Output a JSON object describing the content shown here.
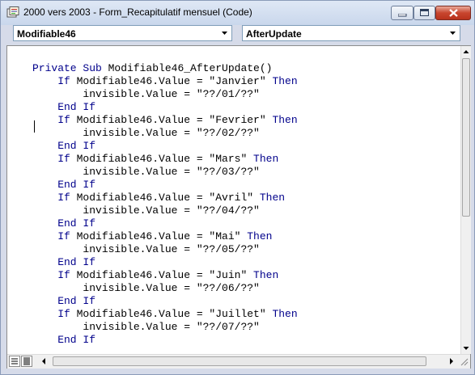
{
  "window": {
    "title": "2000 vers 2003 - Form_Recapitulatif mensuel (Code)"
  },
  "selectors": {
    "object": "Modifiable46",
    "procedure": "AfterUpdate"
  },
  "code": {
    "lines": [
      [
        {
          "t": "Private Sub ",
          "k": true
        },
        {
          "t": "Modifiable46_AfterUpdate()",
          "k": false
        }
      ],
      [
        {
          "t": "    If ",
          "k": true
        },
        {
          "t": "Modifiable46.Value = \"Janvier\" ",
          "k": false
        },
        {
          "t": "Then",
          "k": true
        }
      ],
      [
        {
          "t": "        invisible.Value = \"??/01/??\"",
          "k": false
        }
      ],
      [
        {
          "t": "    End If",
          "k": true
        }
      ],
      [
        {
          "t": "    If ",
          "k": true
        },
        {
          "t": "Modifiable46.Value = \"Fevrier\" ",
          "k": false
        },
        {
          "t": "Then",
          "k": true
        }
      ],
      [
        {
          "t": "        invisible.Value = \"??/02/??\"",
          "k": false
        }
      ],
      [
        {
          "t": "    End If",
          "k": true
        }
      ],
      [
        {
          "t": "    If ",
          "k": true
        },
        {
          "t": "Modifiable46.Value = \"Mars\" ",
          "k": false
        },
        {
          "t": "Then",
          "k": true
        }
      ],
      [
        {
          "t": "        invisible.Value = \"??/03/??\"",
          "k": false
        }
      ],
      [
        {
          "t": "    End If",
          "k": true
        }
      ],
      [
        {
          "t": "    If ",
          "k": true
        },
        {
          "t": "Modifiable46.Value = \"Avril\" ",
          "k": false
        },
        {
          "t": "Then",
          "k": true
        }
      ],
      [
        {
          "t": "        invisible.Value = \"??/04/??\"",
          "k": false
        }
      ],
      [
        {
          "t": "    End If",
          "k": true
        }
      ],
      [
        {
          "t": "    If ",
          "k": true
        },
        {
          "t": "Modifiable46.Value = \"Mai\" ",
          "k": false
        },
        {
          "t": "Then",
          "k": true
        }
      ],
      [
        {
          "t": "        invisible.Value = \"??/05/??\"",
          "k": false
        }
      ],
      [
        {
          "t": "    End If",
          "k": true
        }
      ],
      [
        {
          "t": "    If ",
          "k": true
        },
        {
          "t": "Modifiable46.Value = \"Juin\" ",
          "k": false
        },
        {
          "t": "Then",
          "k": true
        }
      ],
      [
        {
          "t": "        invisible.Value = \"??/06/??\"",
          "k": false
        }
      ],
      [
        {
          "t": "    End If",
          "k": true
        }
      ],
      [
        {
          "t": "    If ",
          "k": true
        },
        {
          "t": "Modifiable46.Value = \"Juillet\" ",
          "k": false
        },
        {
          "t": "Then",
          "k": true
        }
      ],
      [
        {
          "t": "        invisible.Value = \"??/07/??\"",
          "k": false
        }
      ],
      [
        {
          "t": "    End If",
          "k": true
        }
      ]
    ]
  },
  "colors": {
    "keyword": "#00008b",
    "text": "#000000"
  }
}
